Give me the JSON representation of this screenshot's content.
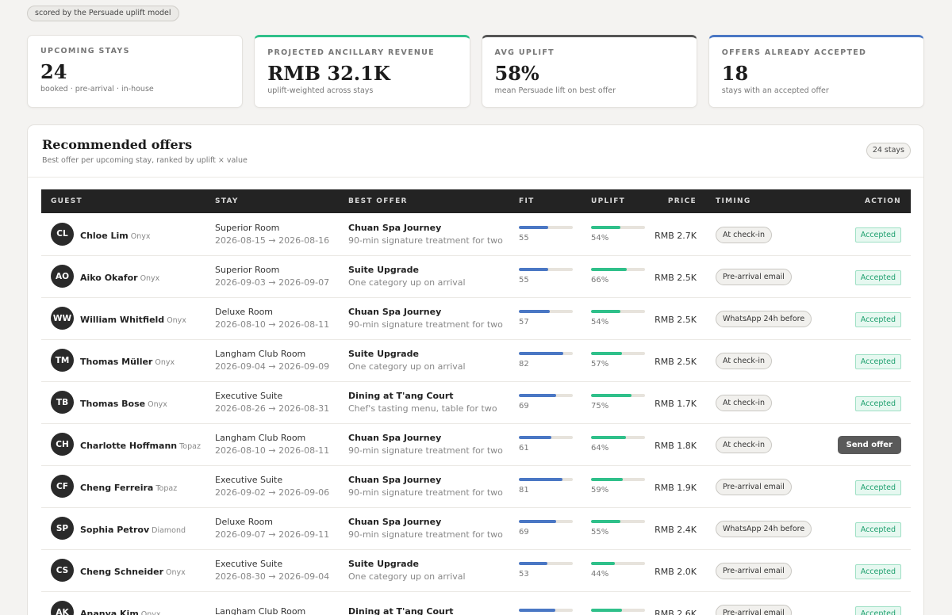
{
  "header_tag": "scored by the Persuade uplift model",
  "kpis": [
    {
      "label": "UPCOMING STAYS",
      "value": "24",
      "sub": "booked · pre-arrival · in-house",
      "accent": ""
    },
    {
      "label": "PROJECTED ANCILLARY REVENUE",
      "value": "RMB 32.1K",
      "sub": "uplift-weighted across stays",
      "accent": "#2fc08a"
    },
    {
      "label": "AVG UPLIFT",
      "value": "58%",
      "sub": "mean Persuade lift on best offer",
      "accent": "#555555"
    },
    {
      "label": "OFFERS ALREADY ACCEPTED",
      "value": "18",
      "sub": "stays with an accepted offer",
      "accent": "#4a77c4"
    }
  ],
  "panel": {
    "title": "Recommended offers",
    "subtitle": "Best offer per upcoming stay, ranked by uplift × value",
    "count_badge": "24 stays"
  },
  "table": {
    "columns": [
      "GUEST",
      "STAY",
      "BEST OFFER",
      "FIT",
      "UPLIFT",
      "PRICE",
      "TIMING",
      "ACTION"
    ],
    "rows": [
      {
        "initials": "CL",
        "name": "Chloe Lim",
        "tier": "Onyx",
        "room": "Superior Room",
        "dates": "2026-08-15 → 2026-08-16",
        "offer": "Chuan Spa Journey",
        "offer_desc": "90-min signature treatment for two",
        "fit": "55",
        "uplift": "54%",
        "uplift_value": 54,
        "price": "RMB 2.7K",
        "timing": "At check-in",
        "action": "Accepted"
      },
      {
        "initials": "AO",
        "name": "Aiko Okafor",
        "tier": "Onyx",
        "room": "Superior Room",
        "dates": "2026-09-03 → 2026-09-07",
        "offer": "Suite Upgrade",
        "offer_desc": "One category up on arrival",
        "fit": "55",
        "uplift": "66%",
        "uplift_value": 66,
        "price": "RMB 2.5K",
        "timing": "Pre-arrival email",
        "action": "Accepted"
      },
      {
        "initials": "WW",
        "name": "William Whitfield",
        "tier": "Onyx",
        "room": "Deluxe Room",
        "dates": "2026-08-10 → 2026-08-11",
        "offer": "Chuan Spa Journey",
        "offer_desc": "90-min signature treatment for two",
        "fit": "57",
        "uplift": "54%",
        "uplift_value": 54,
        "price": "RMB 2.5K",
        "timing": "WhatsApp 24h before",
        "action": "Accepted"
      },
      {
        "initials": "TM",
        "name": "Thomas Müller",
        "tier": "Onyx",
        "room": "Langham Club Room",
        "dates": "2026-09-04 → 2026-09-09",
        "offer": "Suite Upgrade",
        "offer_desc": "One category up on arrival",
        "fit": "82",
        "uplift": "57%",
        "uplift_value": 57,
        "price": "RMB 2.5K",
        "timing": "At check-in",
        "action": "Accepted"
      },
      {
        "initials": "TB",
        "name": "Thomas Bose",
        "tier": "Onyx",
        "room": "Executive Suite",
        "dates": "2026-08-26 → 2026-08-31",
        "offer": "Dining at T'ang Court",
        "offer_desc": "Chef's tasting menu, table for two",
        "fit": "69",
        "uplift": "75%",
        "uplift_value": 75,
        "price": "RMB 1.7K",
        "timing": "At check-in",
        "action": "Accepted"
      },
      {
        "initials": "CH",
        "name": "Charlotte Hoffmann",
        "tier": "Topaz",
        "room": "Langham Club Room",
        "dates": "2026-08-10 → 2026-08-11",
        "offer": "Chuan Spa Journey",
        "offer_desc": "90-min signature treatment for two",
        "fit": "61",
        "uplift": "64%",
        "uplift_value": 64,
        "price": "RMB 1.8K",
        "timing": "At check-in",
        "action": "Send offer"
      },
      {
        "initials": "CF",
        "name": "Cheng Ferreira",
        "tier": "Topaz",
        "room": "Executive Suite",
        "dates": "2026-09-02 → 2026-09-06",
        "offer": "Chuan Spa Journey",
        "offer_desc": "90-min signature treatment for two",
        "fit": "81",
        "uplift": "59%",
        "uplift_value": 59,
        "price": "RMB 1.9K",
        "timing": "Pre-arrival email",
        "action": "Accepted"
      },
      {
        "initials": "SP",
        "name": "Sophia Petrov",
        "tier": "Diamond",
        "room": "Deluxe Room",
        "dates": "2026-09-07 → 2026-09-11",
        "offer": "Chuan Spa Journey",
        "offer_desc": "90-min signature treatment for two",
        "fit": "69",
        "uplift": "55%",
        "uplift_value": 55,
        "price": "RMB 2.4K",
        "timing": "WhatsApp 24h before",
        "action": "Accepted"
      },
      {
        "initials": "CS",
        "name": "Cheng Schneider",
        "tier": "Onyx",
        "room": "Executive Suite",
        "dates": "2026-08-30 → 2026-09-04",
        "offer": "Suite Upgrade",
        "offer_desc": "One category up on arrival",
        "fit": "53",
        "uplift": "44%",
        "uplift_value": 44,
        "price": "RMB 2.0K",
        "timing": "Pre-arrival email",
        "action": "Accepted"
      },
      {
        "initials": "AK",
        "name": "Ananya Kim",
        "tier": "Onyx",
        "room": "Langham Club Room",
        "dates": "",
        "offer": "Dining at T'ang Court",
        "offer_desc": "",
        "fit": "",
        "uplift": "",
        "uplift_value": 58,
        "fit_value": 68,
        "price": "RMB 2.6K",
        "timing": "Pre-arrival email",
        "action": "Accepted"
      }
    ]
  },
  "colors": {
    "fit_bar": "#4a77c4",
    "uplift_bar": "#2fc08a",
    "accepted": "#1fa06f"
  }
}
